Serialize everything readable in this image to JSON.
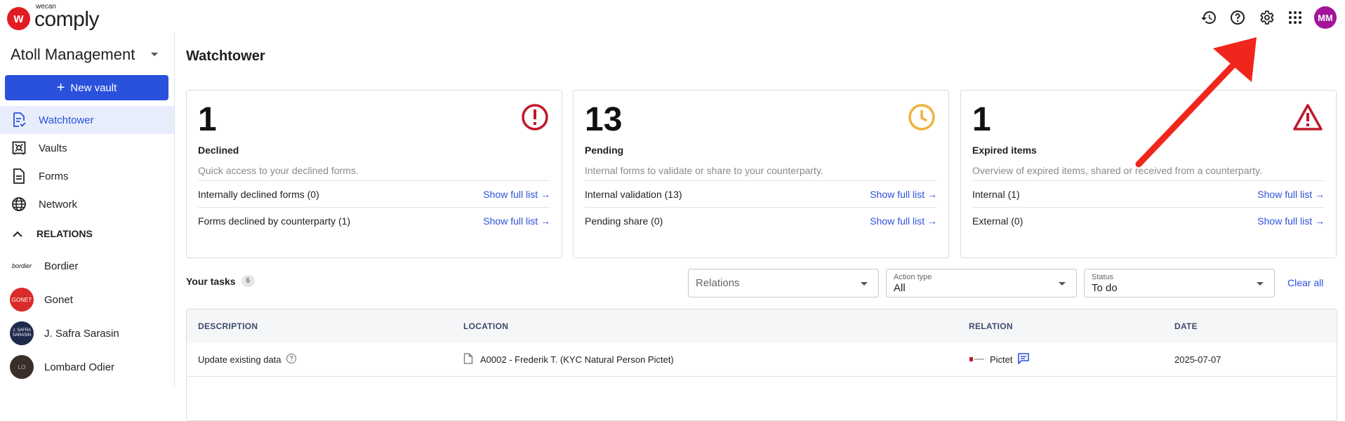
{
  "brand": {
    "small": "wecan",
    "big": "comply",
    "mark": "w",
    "color": "#e31b23"
  },
  "user": {
    "initials": "MM",
    "avatar_color": "#a3149a"
  },
  "top_icons": [
    "history-icon",
    "help-icon",
    "gear-icon",
    "apps-grid-icon"
  ],
  "sidebar": {
    "org_name": "Atoll Management",
    "new_vault_label": "New vault",
    "nav": [
      {
        "label": "Watchtower",
        "icon": "watchtower-icon",
        "active": true
      },
      {
        "label": "Vaults",
        "icon": "vault-icon"
      },
      {
        "label": "Forms",
        "icon": "forms-icon"
      },
      {
        "label": "Network",
        "icon": "globe-icon"
      }
    ],
    "relations_header": "RELATIONS",
    "relations": [
      {
        "name": "Bordier",
        "logo_text": "bordier"
      },
      {
        "name": "Gonet",
        "logo_text": "GONET"
      },
      {
        "name": "J. Safra Sarasin",
        "logo_text": "J. SAFRA SARASIN"
      },
      {
        "name": "Lombard Odier",
        "logo_text": "LO"
      }
    ]
  },
  "main": {
    "title": "Watchtower",
    "cards": [
      {
        "count": "1",
        "title": "Declined",
        "desc": "Quick access to your declined forms.",
        "icon": "error-circle-icon",
        "icon_color": "#c0182b",
        "rows": [
          {
            "label": "Internally declined forms (0)",
            "link": "Show full list"
          },
          {
            "label": "Forms declined by counterparty (1)",
            "link": "Show full list"
          }
        ]
      },
      {
        "count": "13",
        "title": "Pending",
        "desc": "Internal forms to validate or share to your counterparty.",
        "icon": "clock-icon",
        "icon_color": "#f0b23c",
        "rows": [
          {
            "label": "Internal validation (13)",
            "link": "Show full list"
          },
          {
            "label": "Pending share (0)",
            "link": "Show full list"
          }
        ]
      },
      {
        "count": "1",
        "title": "Expired items",
        "desc": "Overview of expired items, shared or received from a counterparty.",
        "icon": "warning-triangle-icon",
        "icon_color": "#c0182b",
        "rows": [
          {
            "label": "Internal (1)",
            "link": "Show full list"
          },
          {
            "label": "External (0)",
            "link": "Show full list"
          }
        ]
      }
    ],
    "tasks": {
      "label": "Your tasks",
      "count": "6",
      "filters": {
        "relations_placeholder": "Relations",
        "action_type_label": "Action type",
        "action_type_value": "All",
        "status_label": "Status",
        "status_value": "To do"
      },
      "clear_all": "Clear all",
      "columns": [
        "DESCRIPTION",
        "LOCATION",
        "RELATION",
        "DATE"
      ],
      "rows": [
        {
          "description": "Update existing data",
          "location": "A0002 - Frederik T. (KYC Natural Person Pictet)",
          "relation": "Pictet",
          "date": "2025-07-07"
        }
      ]
    }
  },
  "accent_color": "#2a51db",
  "annotation_arrow_color": "#f0261c"
}
